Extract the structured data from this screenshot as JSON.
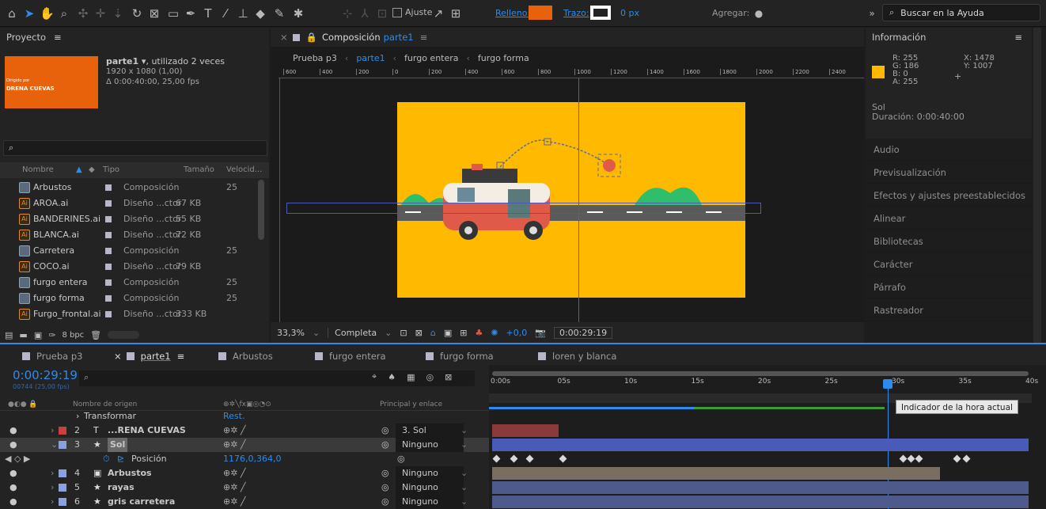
{
  "toolbar": {
    "ajuste": "Ajuste",
    "relleno": "Relleno:",
    "trazo": "Trazo:",
    "px": "0 px",
    "agregar": "Agregar:",
    "search": "Buscar en la Ayuda",
    "fill_color": "#e8620c"
  },
  "project": {
    "title": "Proyecto",
    "comp_name": "parte1 ▾",
    "used": ", utilizado 2 veces",
    "res": "1920 x 1080 (1,00)",
    "dur": "Δ 0:00:40:00, 25,00 fps",
    "thumb_small": "Dirigido por",
    "thumb_big": "DRENA CUEVAS",
    "search_icon": "⌕",
    "cols": {
      "name": "Nombre",
      "type": "Tipo",
      "size": "Tamaño",
      "vel": "Velocid..."
    },
    "rows": [
      {
        "name": "Arbustos",
        "type": "Composición",
        "size": "",
        "vel": "25",
        "kind": "comp"
      },
      {
        "name": "AROA.ai",
        "type": "Diseño ...ctor",
        "size": "67 KB",
        "vel": "",
        "kind": "ai"
      },
      {
        "name": "BANDERINES.ai",
        "type": "Diseño ...ctor",
        "size": "55 KB",
        "vel": "",
        "kind": "ai"
      },
      {
        "name": "BLANCA.ai",
        "type": "Diseño ...ctor",
        "size": "72 KB",
        "vel": "",
        "kind": "ai"
      },
      {
        "name": "Carretera",
        "type": "Composición",
        "size": "",
        "vel": "25",
        "kind": "comp"
      },
      {
        "name": "COCO.ai",
        "type": "Diseño ...ctor",
        "size": "79 KB",
        "vel": "",
        "kind": "ai"
      },
      {
        "name": "furgo entera",
        "type": "Composición",
        "size": "",
        "vel": "25",
        "kind": "comp"
      },
      {
        "name": "furgo forma",
        "type": "Composición",
        "size": "",
        "vel": "25",
        "kind": "comp"
      },
      {
        "name": "Furgo_frontal.ai",
        "type": "Diseño ...ctor",
        "size": "333 KB",
        "vel": "",
        "kind": "ai"
      }
    ],
    "bpc": "8 bpc"
  },
  "comp": {
    "title": "Composición",
    "name": "parte1",
    "crumbs": [
      "Prueba p3",
      "parte1",
      "furgo entera",
      "furgo forma"
    ],
    "ruler": [
      "600",
      "400",
      "200",
      "0",
      "200",
      "400",
      "600",
      "800",
      "1000",
      "1200",
      "1400",
      "1600",
      "1800",
      "2000",
      "2200",
      "2400"
    ],
    "zoom": "33,3%",
    "quality": "Completa",
    "exposure": "+0,0",
    "time": "0:00:29:19"
  },
  "info": {
    "title": "Información",
    "r": "R: 255",
    "g": "G: 186",
    "b": "B: 0",
    "a": "A: 255",
    "x": "X: 1478",
    "y": "Y: 1007",
    "layer": "Sol",
    "duration": "Duración: 0:00:40:00",
    "color": "#ffba00"
  },
  "panels": [
    "Audio",
    "Previsualización",
    "Efectos y ajustes preestablecidos",
    "Alinear",
    "Bibliotecas",
    "Carácter",
    "Párrafo",
    "Rastreador"
  ],
  "tabs": [
    {
      "label": "Prueba p3",
      "color": "#b7b7c9"
    },
    {
      "label": "parte1",
      "color": "#b7b7c9"
    },
    {
      "label": "Arbustos",
      "color": "#b7b7c9"
    },
    {
      "label": "furgo entera",
      "color": "#b7b7c9"
    },
    {
      "label": "furgo forma",
      "color": "#b7b7c9"
    },
    {
      "label": "loren y blanca",
      "color": "#b7b7c9"
    }
  ],
  "timeline": {
    "timecode": "0:00:29:19",
    "frames": "00744 (25,00 fps)",
    "col_source": "Nombre de origen",
    "col_parent": "Principal y enlace",
    "ticks": [
      "0:00s",
      "05s",
      "10s",
      "15s",
      "20s",
      "25s",
      "30s",
      "35s",
      "40s"
    ],
    "tooltip": "Indicador de la hora actual",
    "transform": "Transformar",
    "reset": "Rest.",
    "layers": [
      {
        "num": "2",
        "type": "T",
        "name": "...RENA CUEVAS",
        "parent": "3. Sol",
        "color": "#c84040",
        "bar": "#8a3a3a"
      },
      {
        "num": "3",
        "type": "★",
        "name": "Sol",
        "parent": "Ninguno",
        "color": "#8ca0e0",
        "bar": "#4a5ab8"
      },
      {
        "num": "4",
        "type": "▣",
        "name": "Arbustos",
        "parent": "Ninguno",
        "color": "#8ca0e0",
        "bar": "#7a6e60"
      },
      {
        "num": "5",
        "type": "★",
        "name": "rayas",
        "parent": "Ninguno",
        "color": "#8ca0e0",
        "bar": "#4e5a8c"
      },
      {
        "num": "6",
        "type": "★",
        "name": "gris carretera",
        "parent": "Ninguno",
        "color": "#8ca0e0",
        "bar": "#4e5a8c"
      }
    ],
    "pos_label": "Posición",
    "pos_value": "1176,0,364,0"
  }
}
